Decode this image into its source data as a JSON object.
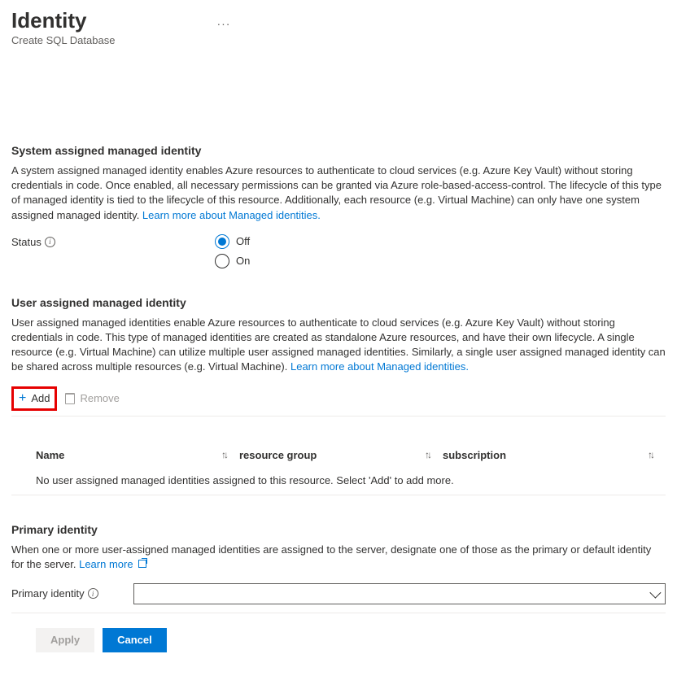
{
  "header": {
    "title": "Identity",
    "subtitle": "Create SQL Database",
    "more_tooltip": "More"
  },
  "system_identity": {
    "heading": "System assigned managed identity",
    "description": "A system assigned managed identity enables Azure resources to authenticate to cloud services (e.g. Azure Key Vault) without storing credentials in code. Once enabled, all necessary permissions can be granted via Azure role-based-access-control. The lifecycle of this type of managed identity is tied to the lifecycle of this resource. Additionally, each resource (e.g. Virtual Machine) can only have one system assigned managed identity. ",
    "learn_more": "Learn more about Managed identities.",
    "status_label": "Status",
    "options": {
      "off": "Off",
      "on": "On"
    },
    "selected": "off"
  },
  "user_identity": {
    "heading": "User assigned managed identity",
    "description": "User assigned managed identities enable Azure resources to authenticate to cloud services (e.g. Azure Key Vault) without storing credentials in code. This type of managed identities are created as standalone Azure resources, and have their own lifecycle. A single resource (e.g. Virtual Machine) can utilize multiple user assigned managed identities. Similarly, a single user assigned managed identity can be shared across multiple resources (e.g. Virtual Machine). ",
    "learn_more": "Learn more about Managed identities.",
    "toolbar": {
      "add": "Add",
      "remove": "Remove"
    },
    "columns": {
      "name": "Name",
      "resource_group": "resource group",
      "subscription": "subscription"
    },
    "empty_text": "No user assigned managed identities assigned to this resource. Select 'Add' to add more."
  },
  "primary_identity": {
    "heading": "Primary identity",
    "description": "When one or more user-assigned managed identities are assigned to the server, designate one of those as the primary or default identity for the server. ",
    "learn_more": "Learn more",
    "label": "Primary identity"
  },
  "footer": {
    "apply": "Apply",
    "cancel": "Cancel"
  }
}
